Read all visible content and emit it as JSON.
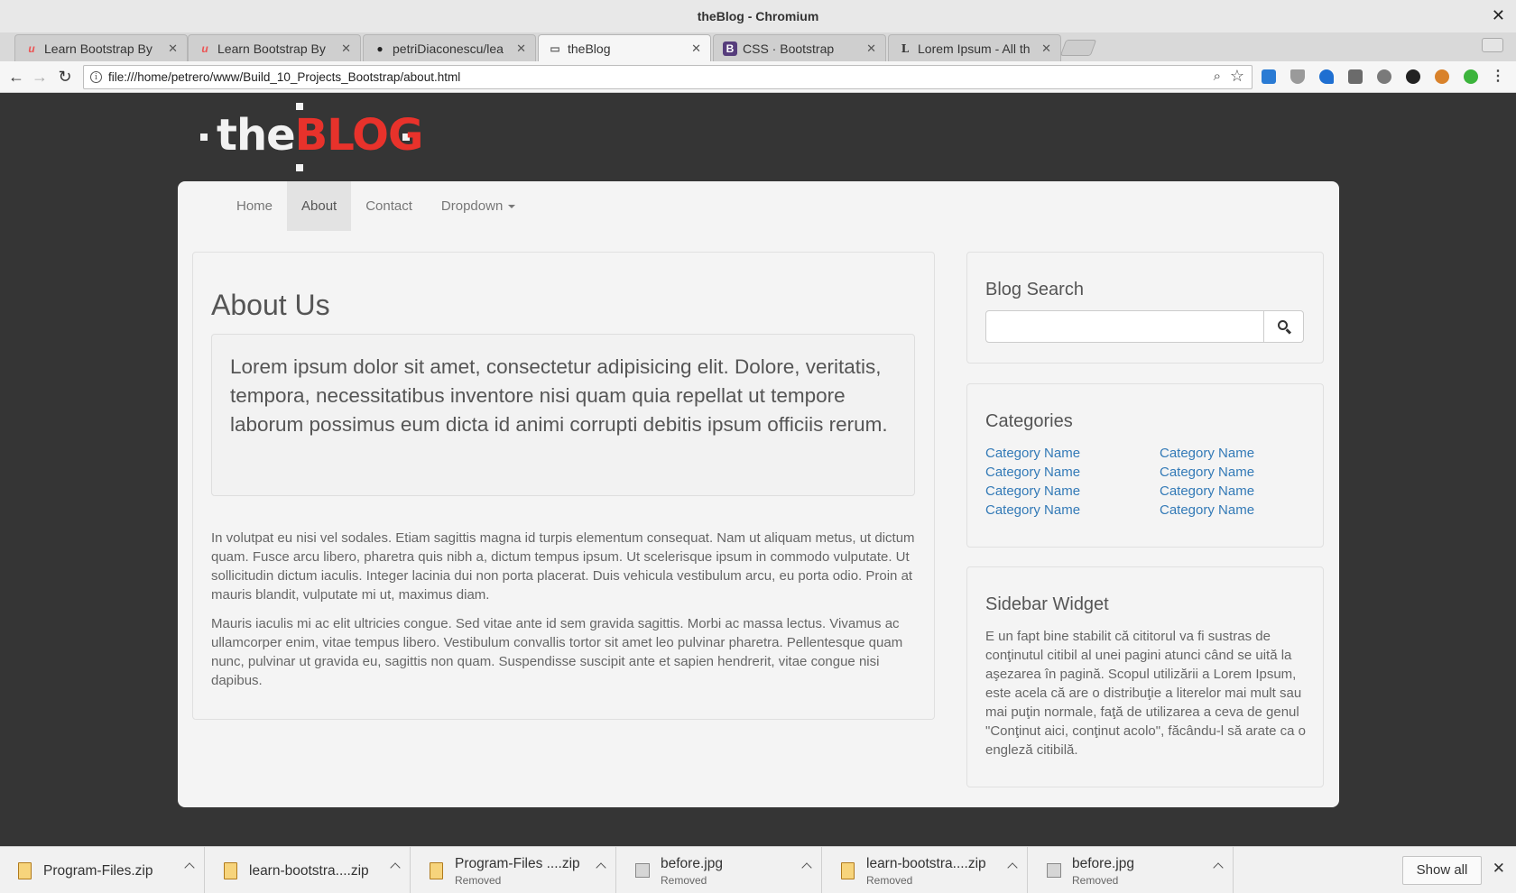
{
  "window": {
    "title": "theBlog - Chromium",
    "close_glyph": "✕"
  },
  "tabs": [
    {
      "title": "Learn Bootstrap By",
      "favicon": "udemy-icon",
      "favicon_text": "u",
      "favicon_color": "#ec5252"
    },
    {
      "title": "Learn Bootstrap By",
      "favicon": "udemy-icon",
      "favicon_text": "u",
      "favicon_color": "#ec5252"
    },
    {
      "title": "petriDiaconescu/lea",
      "favicon": "github-icon",
      "favicon_text": "●",
      "favicon_color": "#222222"
    },
    {
      "title": "theBlog",
      "favicon": "page-icon",
      "favicon_text": "▭",
      "favicon_color": "#666666",
      "active": true
    },
    {
      "title": "CSS · Bootstrap",
      "favicon": "bootstrap-icon",
      "favicon_text": "B",
      "favicon_color": "#563d7c"
    },
    {
      "title": "Lorem Ipsum - All th",
      "favicon": "lorem-icon",
      "favicon_text": "L",
      "favicon_color": "#333333"
    }
  ],
  "toolbar": {
    "back": "←",
    "forward": "→",
    "reload": "↻",
    "url": "file:///home/petrero/www/Build_10_Projects_Bootstrap/about.html",
    "zoom": "⌕",
    "star": "☆",
    "menu": "⋮",
    "info": "i",
    "extensions": [
      {
        "name": "bookmark-ext-icon",
        "color": "#2a7bd4"
      },
      {
        "name": "shield-ext-icon",
        "color": "#9a9a9a"
      },
      {
        "name": "bird-ext-icon",
        "color": "#1f6fd1"
      },
      {
        "name": "download-ext-icon",
        "color": "#6b6b6b"
      },
      {
        "name": "recycle-ext-icon",
        "color": "#7a7a7a"
      },
      {
        "name": "cat-ext-icon",
        "color": "#222222"
      },
      {
        "name": "fox-ext-icon",
        "color": "#d9822b"
      },
      {
        "name": "green-ext-icon",
        "color": "#3cb43c"
      }
    ]
  },
  "logo": {
    "the": "the",
    "blog": "BLOG"
  },
  "nav": {
    "items": [
      "Home",
      "About",
      "Contact",
      "Dropdown"
    ],
    "active_index": 1
  },
  "main": {
    "heading": "About Us",
    "lead": "Lorem ipsum dolor sit amet, consectetur adipisicing elit. Dolore, veritatis, tempora, necessitatibus inventore nisi quam quia repellat ut tempore laborum possimus eum dicta id animi corrupti debitis ipsum officiis rerum.",
    "paragraphs": [
      "In volutpat eu nisi vel sodales. Etiam sagittis magna id turpis elementum consequat. Nam ut aliquam metus, ut dictum quam. Fusce arcu libero, pharetra quis nibh a, dictum tempus ipsum. Ut scelerisque ipsum in commodo vulputate. Ut sollicitudin dictum iaculis. Integer lacinia dui non porta placerat. Duis vehicula vestibulum arcu, eu porta odio. Proin at mauris blandit, vulputate mi ut, maximus diam.",
      "Mauris iaculis mi ac elit ultricies congue. Sed vitae ante id sem gravida sagittis. Morbi ac massa lectus. Vivamus ac ullamcorper enim, vitae tempus libero. Vestibulum convallis tortor sit amet leo pulvinar pharetra. Pellentesque quam nunc, pulvinar ut gravida eu, sagittis non quam. Suspendisse suscipit ante et sapien hendrerit, vitae congue nisi dapibus."
    ]
  },
  "sidebar": {
    "search_title": "Blog Search",
    "search_value": "",
    "categories_title": "Categories",
    "categories": [
      "Category Name",
      "Category Name",
      "Category Name",
      "Category Name",
      "Category Name",
      "Category Name",
      "Category Name",
      "Category Name"
    ],
    "widget_title": "Sidebar Widget",
    "widget_text": "E un fapt bine stabilit că cititorul va fi sustras de conţinutul citibil al unei pagini atunci când se uită la aşezarea în pagină. Scopul utilizării a Lorem Ipsum, este acela că are o distribuţie a literelor mai mult sau mai puţin normale, faţă de utilizarea a ceva de genul \"Conţinut aici, conţinut acolo\", făcându-l să arate ca o engleză citibilă."
  },
  "downloads": {
    "items": [
      {
        "name": "Program-Files.zip",
        "status": "",
        "kind": "zip"
      },
      {
        "name": "learn-bootstra....zip",
        "status": "",
        "kind": "zip"
      },
      {
        "name": "Program-Files ....zip",
        "status": "Removed",
        "kind": "zip"
      },
      {
        "name": "before.jpg",
        "status": "Removed",
        "kind": "image"
      },
      {
        "name": "learn-bootstra....zip",
        "status": "Removed",
        "kind": "zip"
      },
      {
        "name": "before.jpg",
        "status": "Removed",
        "kind": "image"
      }
    ],
    "show_all": "Show all",
    "close": "✕"
  }
}
